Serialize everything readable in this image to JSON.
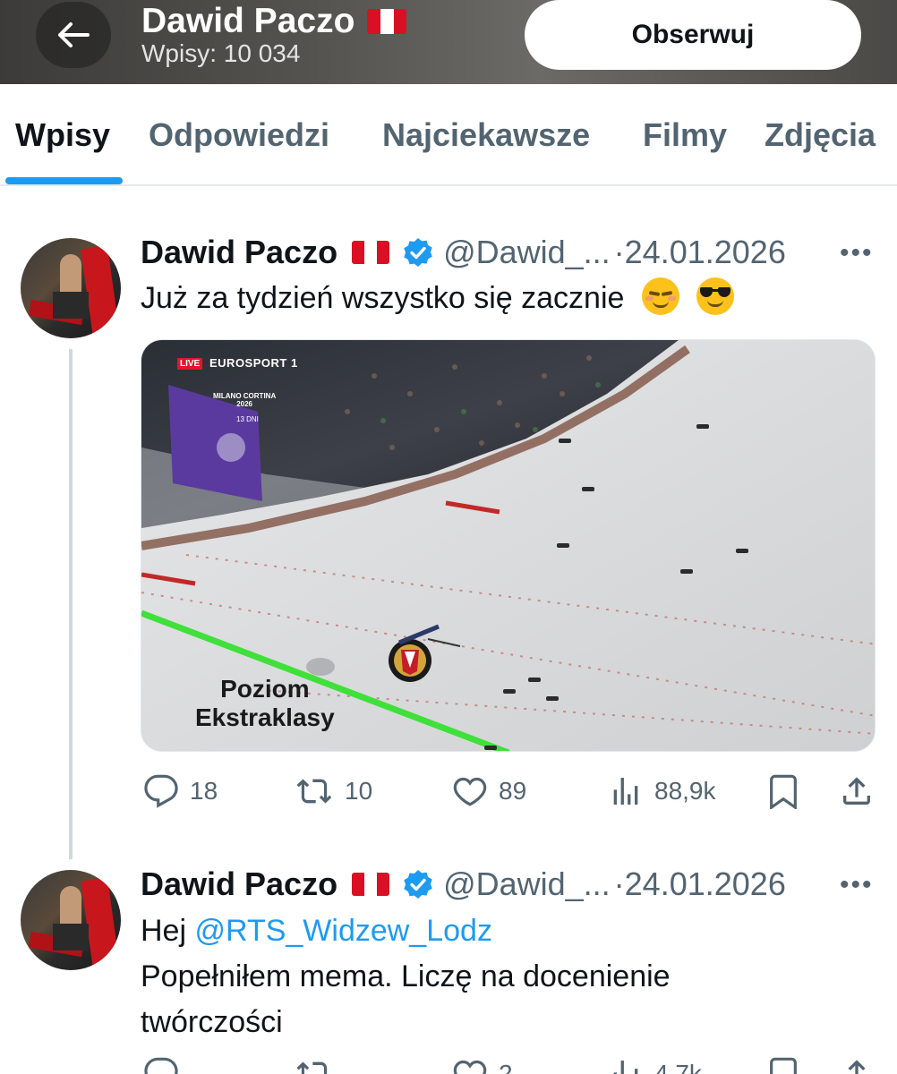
{
  "header": {
    "name": "Dawid Paczo",
    "posts_count_label": "Wpisy: 10 034",
    "follow_label": "Obserwuj"
  },
  "tabs": [
    "Wpisy",
    "Odpowiedzi",
    "Najciekawsze",
    "Filmy",
    "Zdjęcia"
  ],
  "active_tab": "Wpisy",
  "posts": [
    {
      "name": "Dawid Paczo",
      "handle": "@Dawid_...",
      "date": "·24.01.2026",
      "more": "•••",
      "text": "Już za tydzień wszystko się zacznie",
      "emojis": [
        "relieved-face-icon",
        "smiling-face-with-sunglasses-icon"
      ],
      "media": {
        "live": "LIVE",
        "channel": "EUROSPORT 1",
        "games_line1": "MILANO CORTINA",
        "games_line2": "2026",
        "countdown": "13 DNI",
        "caption_line1": "Poziom",
        "caption_line2": "Ekstraklasy"
      },
      "stats": {
        "replies": "18",
        "reposts": "10",
        "likes": "89",
        "views": "88,9k"
      }
    },
    {
      "name": "Dawid Paczo",
      "handle": "@Dawid_...",
      "date": "·24.01.2026",
      "more": "•••",
      "greeting": "Hej",
      "mention": "@RTS_Widzew_Lodz",
      "text_line2": "Popełniłem mema. Liczę na docenienie",
      "text_line3": "twórczości",
      "stats": {
        "replies": "",
        "reposts": "",
        "likes": "2",
        "views": "4,7k"
      }
    }
  ],
  "colors": {
    "accent": "#1d9bf0",
    "muted_text": "#536471",
    "verified": "#1d9bf0",
    "flag_red": "#d91023"
  }
}
